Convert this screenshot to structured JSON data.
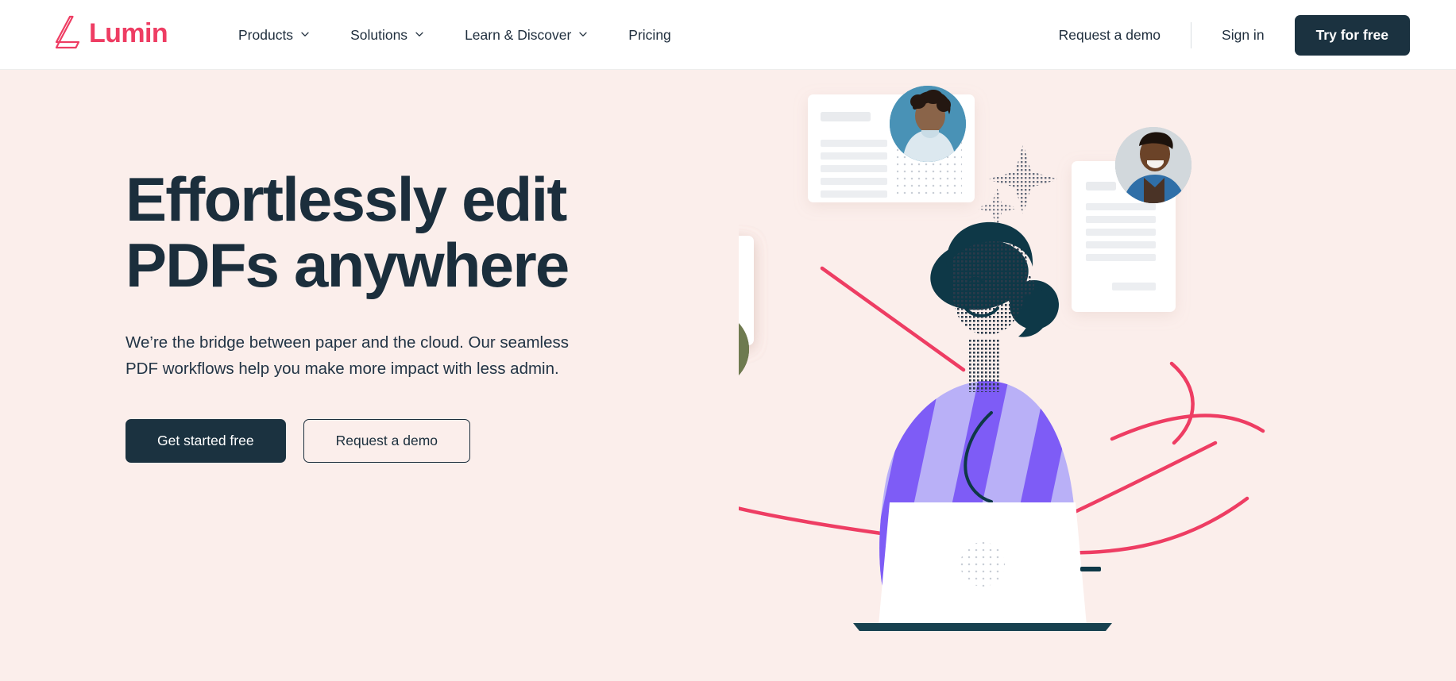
{
  "brand": {
    "name": "Lumin",
    "logo_icon": "lumin-l-mark",
    "accent_color": "#EE3D63",
    "dark_color": "#1B3240",
    "hero_bg_color": "#FBEEEB"
  },
  "header": {
    "nav_items": [
      {
        "label": "Products",
        "has_dropdown": true,
        "icon": "chevron-down-icon"
      },
      {
        "label": "Solutions",
        "has_dropdown": true,
        "icon": "chevron-down-icon"
      },
      {
        "label": "Learn & Discover",
        "has_dropdown": true,
        "icon": "chevron-down-icon"
      },
      {
        "label": "Pricing",
        "has_dropdown": false,
        "icon": ""
      }
    ],
    "request_demo_label": "Request a demo",
    "sign_in_label": "Sign in",
    "try_free_label": "Try for free"
  },
  "hero": {
    "title_line1": "Effortlessly edit",
    "title_line2": "PDFs anywhere",
    "subtitle": "We’re the bridge between paper and the cloud. Our seamless PDF workflows help you make more impact with less admin.",
    "primary_cta": "Get started free",
    "secondary_cta": "Request a demo",
    "illustration": {
      "name": "pdf-collaboration-illustration",
      "documents": [
        {
          "name": "document-card-top-center",
          "style": "landscape-card-with-text-lines-and-dot-grid"
        },
        {
          "name": "document-card-left",
          "style": "portrait-card-with-text-lines-and-dot-grid"
        },
        {
          "name": "document-card-right",
          "style": "portrait-card-with-text-lines"
        }
      ],
      "avatars": [
        {
          "name": "avatar-top-right",
          "bg_color": "#3E93B8",
          "description": "person with curly hair in light hoodie"
        },
        {
          "name": "avatar-left",
          "bg_color": "#7A6B4F",
          "description": "person with blonde hair smiling"
        },
        {
          "name": "avatar-right",
          "bg_color": "#8FA0AE",
          "description": "person in blue blazer smiling"
        }
      ],
      "character": {
        "name": "person-at-laptop",
        "hair_color": "#0E3847",
        "sweater_colors": [
          "#7E5CF6",
          "#B9B0F7"
        ],
        "laptop_color": "#FFFFFF"
      },
      "sparkles": [
        {
          "name": "sparkle-large",
          "style": "dotted-four-point-star"
        },
        {
          "name": "sparkle-small",
          "style": "dotted-four-point-star"
        }
      ],
      "connector_color": "#EE3D63"
    }
  }
}
